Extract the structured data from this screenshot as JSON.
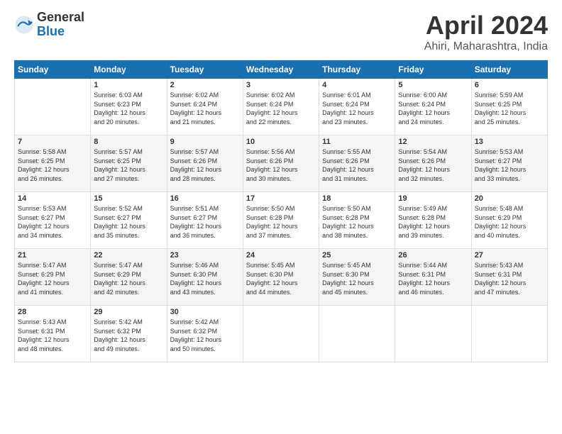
{
  "header": {
    "logo_general": "General",
    "logo_blue": "Blue",
    "title": "April 2024",
    "location": "Ahiri, Maharashtra, India"
  },
  "calendar": {
    "days_of_week": [
      "Sunday",
      "Monday",
      "Tuesday",
      "Wednesday",
      "Thursday",
      "Friday",
      "Saturday"
    ],
    "weeks": [
      [
        {
          "day": "",
          "info": ""
        },
        {
          "day": "1",
          "info": "Sunrise: 6:03 AM\nSunset: 6:23 PM\nDaylight: 12 hours\nand 20 minutes."
        },
        {
          "day": "2",
          "info": "Sunrise: 6:02 AM\nSunset: 6:24 PM\nDaylight: 12 hours\nand 21 minutes."
        },
        {
          "day": "3",
          "info": "Sunrise: 6:02 AM\nSunset: 6:24 PM\nDaylight: 12 hours\nand 22 minutes."
        },
        {
          "day": "4",
          "info": "Sunrise: 6:01 AM\nSunset: 6:24 PM\nDaylight: 12 hours\nand 23 minutes."
        },
        {
          "day": "5",
          "info": "Sunrise: 6:00 AM\nSunset: 6:24 PM\nDaylight: 12 hours\nand 24 minutes."
        },
        {
          "day": "6",
          "info": "Sunrise: 5:59 AM\nSunset: 6:25 PM\nDaylight: 12 hours\nand 25 minutes."
        }
      ],
      [
        {
          "day": "7",
          "info": "Sunrise: 5:58 AM\nSunset: 6:25 PM\nDaylight: 12 hours\nand 26 minutes."
        },
        {
          "day": "8",
          "info": "Sunrise: 5:57 AM\nSunset: 6:25 PM\nDaylight: 12 hours\nand 27 minutes."
        },
        {
          "day": "9",
          "info": "Sunrise: 5:57 AM\nSunset: 6:26 PM\nDaylight: 12 hours\nand 28 minutes."
        },
        {
          "day": "10",
          "info": "Sunrise: 5:56 AM\nSunset: 6:26 PM\nDaylight: 12 hours\nand 30 minutes."
        },
        {
          "day": "11",
          "info": "Sunrise: 5:55 AM\nSunset: 6:26 PM\nDaylight: 12 hours\nand 31 minutes."
        },
        {
          "day": "12",
          "info": "Sunrise: 5:54 AM\nSunset: 6:26 PM\nDaylight: 12 hours\nand 32 minutes."
        },
        {
          "day": "13",
          "info": "Sunrise: 5:53 AM\nSunset: 6:27 PM\nDaylight: 12 hours\nand 33 minutes."
        }
      ],
      [
        {
          "day": "14",
          "info": "Sunrise: 5:53 AM\nSunset: 6:27 PM\nDaylight: 12 hours\nand 34 minutes."
        },
        {
          "day": "15",
          "info": "Sunrise: 5:52 AM\nSunset: 6:27 PM\nDaylight: 12 hours\nand 35 minutes."
        },
        {
          "day": "16",
          "info": "Sunrise: 5:51 AM\nSunset: 6:27 PM\nDaylight: 12 hours\nand 36 minutes."
        },
        {
          "day": "17",
          "info": "Sunrise: 5:50 AM\nSunset: 6:28 PM\nDaylight: 12 hours\nand 37 minutes."
        },
        {
          "day": "18",
          "info": "Sunrise: 5:50 AM\nSunset: 6:28 PM\nDaylight: 12 hours\nand 38 minutes."
        },
        {
          "day": "19",
          "info": "Sunrise: 5:49 AM\nSunset: 6:28 PM\nDaylight: 12 hours\nand 39 minutes."
        },
        {
          "day": "20",
          "info": "Sunrise: 5:48 AM\nSunset: 6:29 PM\nDaylight: 12 hours\nand 40 minutes."
        }
      ],
      [
        {
          "day": "21",
          "info": "Sunrise: 5:47 AM\nSunset: 6:29 PM\nDaylight: 12 hours\nand 41 minutes."
        },
        {
          "day": "22",
          "info": "Sunrise: 5:47 AM\nSunset: 6:29 PM\nDaylight: 12 hours\nand 42 minutes."
        },
        {
          "day": "23",
          "info": "Sunrise: 5:46 AM\nSunset: 6:30 PM\nDaylight: 12 hours\nand 43 minutes."
        },
        {
          "day": "24",
          "info": "Sunrise: 5:45 AM\nSunset: 6:30 PM\nDaylight: 12 hours\nand 44 minutes."
        },
        {
          "day": "25",
          "info": "Sunrise: 5:45 AM\nSunset: 6:30 PM\nDaylight: 12 hours\nand 45 minutes."
        },
        {
          "day": "26",
          "info": "Sunrise: 5:44 AM\nSunset: 6:31 PM\nDaylight: 12 hours\nand 46 minutes."
        },
        {
          "day": "27",
          "info": "Sunrise: 5:43 AM\nSunset: 6:31 PM\nDaylight: 12 hours\nand 47 minutes."
        }
      ],
      [
        {
          "day": "28",
          "info": "Sunrise: 5:43 AM\nSunset: 6:31 PM\nDaylight: 12 hours\nand 48 minutes."
        },
        {
          "day": "29",
          "info": "Sunrise: 5:42 AM\nSunset: 6:32 PM\nDaylight: 12 hours\nand 49 minutes."
        },
        {
          "day": "30",
          "info": "Sunrise: 5:42 AM\nSunset: 6:32 PM\nDaylight: 12 hours\nand 50 minutes."
        },
        {
          "day": "",
          "info": ""
        },
        {
          "day": "",
          "info": ""
        },
        {
          "day": "",
          "info": ""
        },
        {
          "day": "",
          "info": ""
        }
      ]
    ]
  }
}
